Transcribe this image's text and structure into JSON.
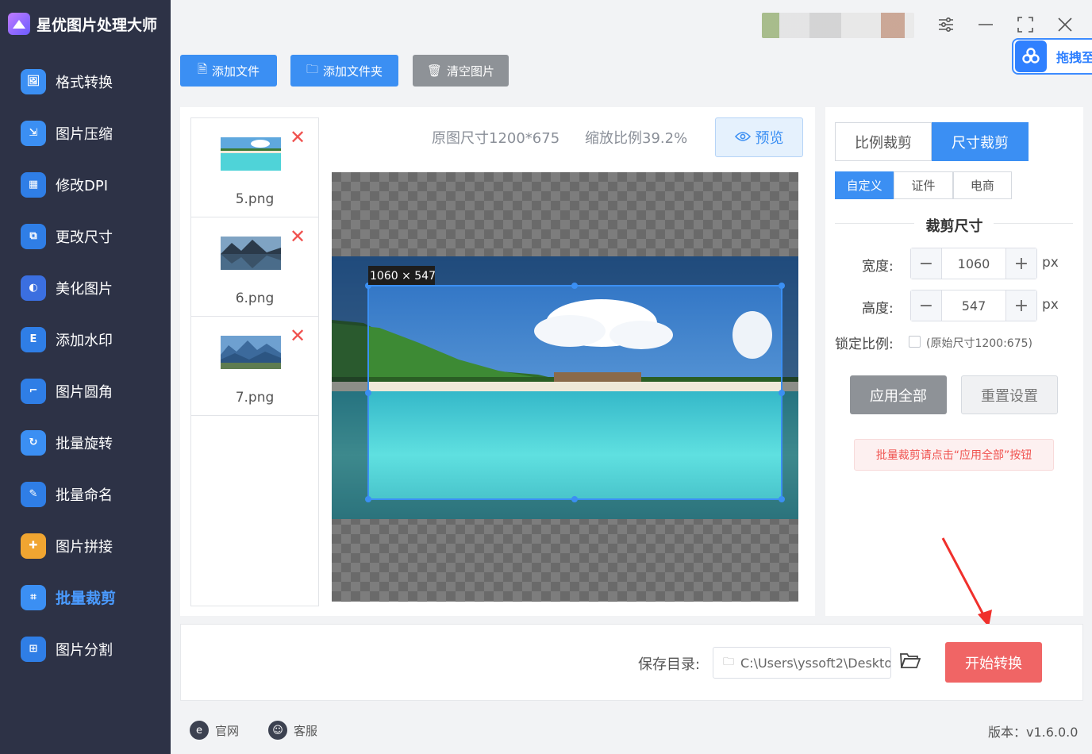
{
  "app": {
    "title": "星优图片处理大师"
  },
  "sidebar": {
    "items": [
      {
        "label": "格式转换",
        "icon": "image-convert-icon",
        "color": "#3b8ff3",
        "glyph": "🖼"
      },
      {
        "label": "图片压缩",
        "icon": "compress-icon",
        "color": "#3b8ff3",
        "glyph": "⇲"
      },
      {
        "label": "修改DPI",
        "icon": "dpi-icon",
        "color": "#2f7ee6",
        "glyph": "▦"
      },
      {
        "label": "更改尺寸",
        "icon": "resize-icon",
        "color": "#2f7ee6",
        "glyph": "⧉"
      },
      {
        "label": "美化图片",
        "icon": "beautify-icon",
        "color": "#3b6fe0",
        "glyph": "◐"
      },
      {
        "label": "添加水印",
        "icon": "watermark-icon",
        "color": "#2f7ee6",
        "glyph": "E"
      },
      {
        "label": "图片圆角",
        "icon": "round-corner-icon",
        "color": "#2f7ee6",
        "glyph": "⌐"
      },
      {
        "label": "批量旋转",
        "icon": "rotate-icon",
        "color": "#3b8ff3",
        "glyph": "↻"
      },
      {
        "label": "批量命名",
        "icon": "rename-icon",
        "color": "#2f7ee6",
        "glyph": "✎"
      },
      {
        "label": "图片拼接",
        "icon": "puzzle-icon",
        "color": "#f0a531",
        "glyph": "✚"
      },
      {
        "label": "批量裁剪",
        "icon": "crop-icon",
        "color": "#3b8ff3",
        "glyph": "⌗",
        "active": true
      },
      {
        "label": "图片分割",
        "icon": "split-icon",
        "color": "#2f7ee6",
        "glyph": "⊞"
      }
    ]
  },
  "topbar": {
    "drag_label": "拖拽至",
    "add_file": "添加文件",
    "add_folder": "添加文件夹",
    "clear_images": "清空图片"
  },
  "files": [
    {
      "name": "5.png",
      "thumb": "beach"
    },
    {
      "name": "6.png",
      "thumb": "lake"
    },
    {
      "name": "7.png",
      "thumb": "mountains"
    }
  ],
  "preview": {
    "original_size": "原图尺寸1200*675",
    "zoom": "缩放比例39.2%",
    "preview_label": "预览",
    "crop_badge": "1060 × 547"
  },
  "settings": {
    "mode_tabs": [
      "比例裁剪",
      "尺寸裁剪"
    ],
    "active_mode": 1,
    "sub_tabs": [
      "自定义",
      "证件",
      "电商"
    ],
    "active_sub": 0,
    "section_title": "裁剪尺寸",
    "width_label": "宽度:",
    "width_value": "1060",
    "height_label": "高度:",
    "height_value": "547",
    "unit": "px",
    "lock_label": "锁定比例:",
    "lock_hint": "(原始尺寸1200:675)",
    "lock_checked": false,
    "apply_all": "应用全部",
    "reset": "重置设置",
    "tip": "批量裁剪请点击“应用全部”按钮"
  },
  "save": {
    "label": "保存目录:",
    "path": "C:\\Users\\yssoft2\\Deskto",
    "start": "开始转换"
  },
  "footer": {
    "website": "官网",
    "support": "客服",
    "version": "版本：v1.6.0.0"
  }
}
